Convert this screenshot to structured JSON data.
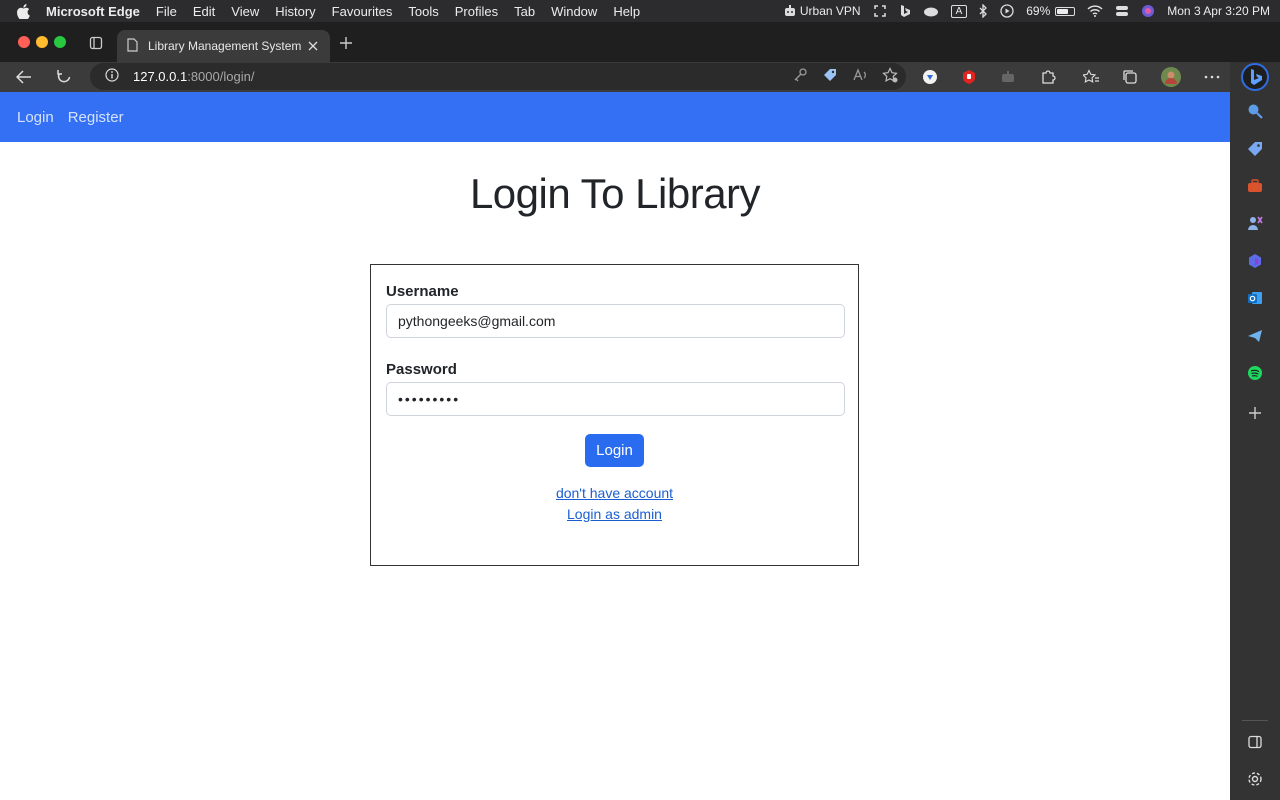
{
  "menubar": {
    "app_name": "Microsoft Edge",
    "menus": [
      "File",
      "Edit",
      "View",
      "History",
      "Favourites",
      "Tools",
      "Profiles",
      "Tab",
      "Window",
      "Help"
    ],
    "vpn_label": "Urban VPN",
    "input_source": "A",
    "battery_percent": "69%",
    "battery_level": 0.69,
    "datetime": "Mon 3 Apr  3:20 PM"
  },
  "browser": {
    "tab_title": "Library Management System",
    "url_host": "127.0.0.1",
    "url_path": ":8000/login/"
  },
  "navbar": {
    "links": [
      "Login",
      "Register"
    ]
  },
  "page": {
    "title": "Login To Library"
  },
  "form": {
    "username_label": "Username",
    "username_value": "pythongeeks@gmail.com",
    "password_label": "Password",
    "password_value": "•••••••••",
    "login_button": "Login",
    "register_link": "don't have account",
    "admin_link": "Login as admin"
  },
  "colors": {
    "navbar": "#3370f4",
    "button": "#2a6cf0",
    "link": "#1a5fd0"
  }
}
